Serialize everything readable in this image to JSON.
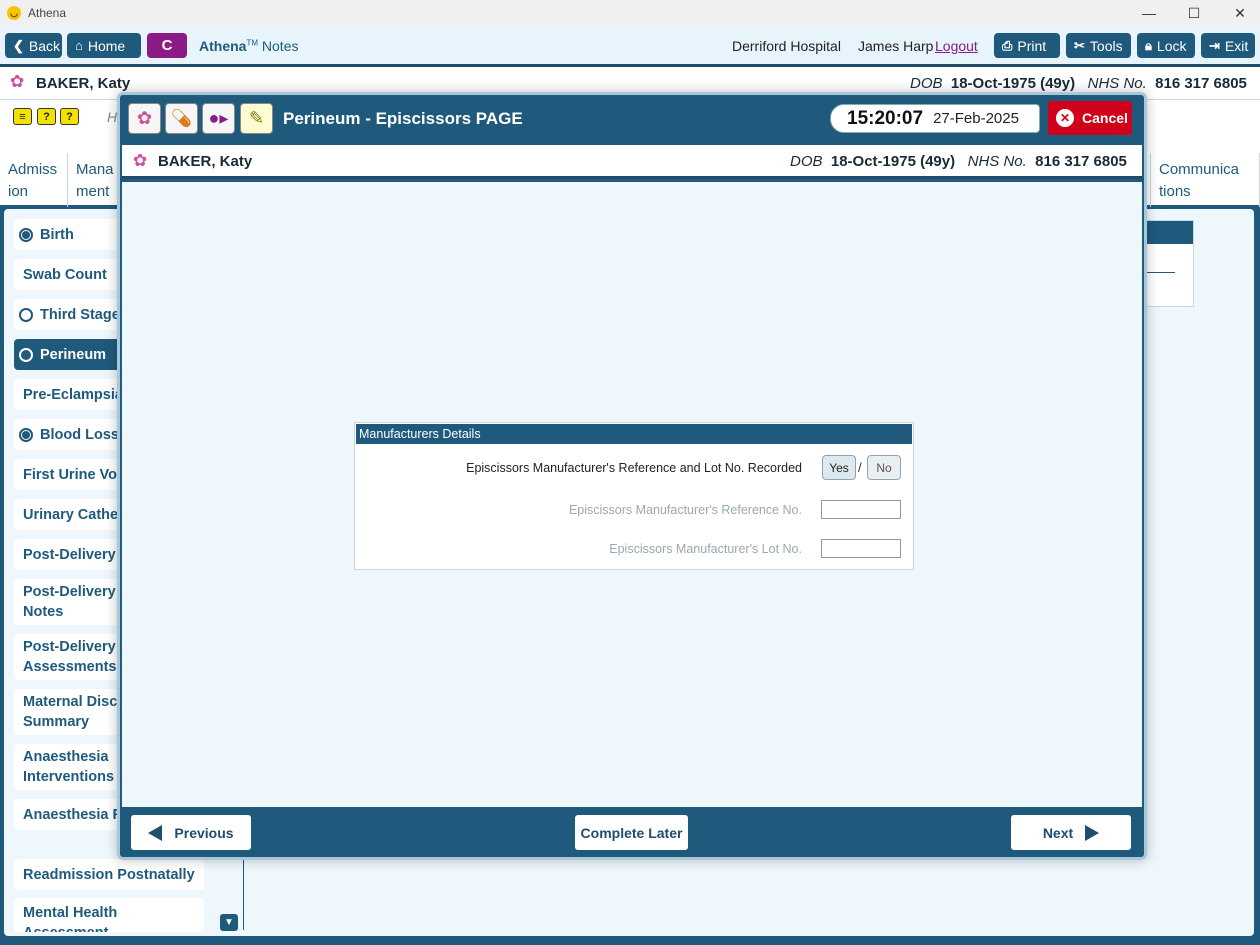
{
  "window": {
    "title": "Athena"
  },
  "toolbar": {
    "back": "Back",
    "home": "Home",
    "c_button": "C",
    "brand": "Athena",
    "brand_tm": "TM",
    "brand_suffix": "Notes",
    "hospital": "Derriford Hospital",
    "user": "James Harp",
    "logout": "Logout",
    "print": "Print",
    "tools": "Tools",
    "lock": "Lock",
    "exit": "Exit"
  },
  "patient": {
    "name": "BAKER, Katy",
    "dob_label": "DOB",
    "dob": "18-Oct-1975 (49y)",
    "nhs_label": "NHS No.",
    "nhs": "816 317 6805"
  },
  "background": {
    "subbar_letter": "H",
    "tabs": [
      "Admiss ion",
      "Mana ment",
      "Communica tions"
    ],
    "sidebar": [
      {
        "label": "Birth",
        "radio": "filled"
      },
      {
        "label": "Swab Count",
        "radio": "none"
      },
      {
        "label": "Third Stage",
        "radio": "empty"
      },
      {
        "label": "Perineum",
        "radio": "empty",
        "active": true
      },
      {
        "label": "Pre-Eclampsia",
        "radio": "none"
      },
      {
        "label": "Blood Loss",
        "radio": "filled"
      },
      {
        "label": "First Urine Voi",
        "radio": "none"
      },
      {
        "label": "Urinary Cathe",
        "radio": "none"
      },
      {
        "label": "Post-Delivery",
        "radio": "none"
      },
      {
        "label": "Post-Delivery Notes",
        "radio": "none"
      },
      {
        "label": "Post-Delivery Assessments",
        "radio": "none"
      },
      {
        "label": "Maternal Disc Summary",
        "radio": "none"
      },
      {
        "label": "Anaesthesia Interventions",
        "radio": "none"
      },
      {
        "label": "Anaesthesia F",
        "radio": "none"
      },
      {
        "label": "Readmission Postnatally",
        "radio": "none"
      },
      {
        "label": "Mental Health Assessment",
        "radio": "none"
      }
    ]
  },
  "modal": {
    "title": "Perineum - Episcissors PAGE",
    "time": "15:20:07",
    "date": "27-Feb-2025",
    "cancel": "Cancel",
    "panel": {
      "heading": "Manufacturers Details",
      "question": "Episcissors Manufacturer's Reference and Lot No. Recorded",
      "yes": "Yes",
      "separator": "/",
      "no": "No",
      "ref_label": "Episcissors Manufacturer's Reference No.",
      "ref_value": "",
      "lot_label": "Episcissors Manufacturer's Lot No.",
      "lot_value": ""
    },
    "footer": {
      "previous": "Previous",
      "complete_later": "Complete Later",
      "next": "Next"
    }
  }
}
